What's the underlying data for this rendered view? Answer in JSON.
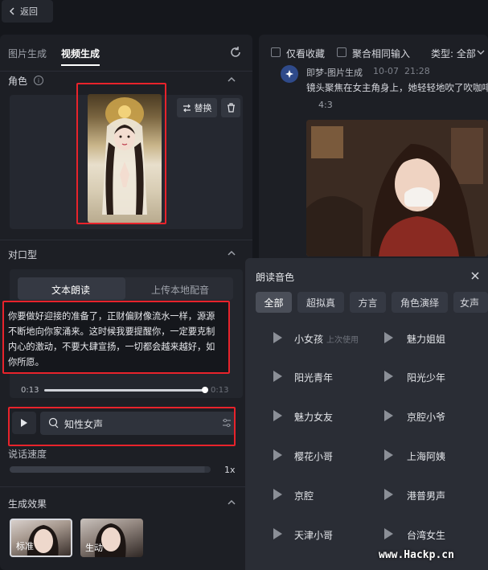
{
  "header": {
    "back_label": "返回"
  },
  "left": {
    "tabs": [
      {
        "label": "图片生成"
      },
      {
        "label": "视频生成"
      }
    ],
    "role": {
      "title": "角色",
      "info": "i",
      "replace_label": "替换"
    },
    "lip": {
      "title": "对口型",
      "modes": [
        {
          "label": "文本朗读"
        },
        {
          "label": "上传本地配音"
        }
      ],
      "text_line1": "你要做好迎接的准备了，正财偏财像流水一样，源源",
      "text_line2": "不断地向你家涌来。这时候我要提醒你，一定要克制",
      "text_line3": "内心的激动，不要大肆宣扬，一切都会越来越好，如",
      "text_line4": "你所愿。",
      "time_start": "0:13",
      "time_end": "0:13",
      "progress": 1.0,
      "voice_name": "知性女声"
    },
    "speed": {
      "title": "说话速度",
      "value": "1x",
      "level": 0.97
    },
    "effect": {
      "title": "生成效果",
      "items": [
        {
          "label": "标准"
        },
        {
          "label": "生动"
        }
      ]
    }
  },
  "right": {
    "filters": {
      "favorites": "仅看收藏",
      "merge": "聚合相同输入",
      "type": "类型: 全部"
    },
    "feed": {
      "source": "即梦-图片生成",
      "date": "10-07",
      "time": "21:28",
      "prompt": "镜头聚焦在女主角身上，她轻轻地吹了吹咖啡",
      "ratio": "4:3"
    }
  },
  "voice_panel": {
    "title": "朗读音色",
    "categories": [
      {
        "label": "全部"
      },
      {
        "label": "超拟真"
      },
      {
        "label": "方言"
      },
      {
        "label": "角色演绎"
      },
      {
        "label": "女声"
      }
    ],
    "voices": [
      {
        "name": "小女孩",
        "note": "上次使用"
      },
      {
        "name": "魅力姐姐",
        "note": ""
      },
      {
        "name": "阳光青年",
        "note": ""
      },
      {
        "name": "阳光少年",
        "note": ""
      },
      {
        "name": "魅力女友",
        "note": ""
      },
      {
        "name": "京腔小爷",
        "note": ""
      },
      {
        "name": "樱花小哥",
        "note": ""
      },
      {
        "name": "上海阿姨",
        "note": ""
      },
      {
        "name": "京腔",
        "note": ""
      },
      {
        "name": "港普男声",
        "note": ""
      },
      {
        "name": "天津小哥",
        "note": ""
      },
      {
        "name": "台湾女生",
        "note": ""
      }
    ]
  },
  "watermark": "www.Hackp.cn",
  "colors": {
    "highlight": "#e8232b",
    "panel": "#1d1f25",
    "background": "#15171c"
  }
}
